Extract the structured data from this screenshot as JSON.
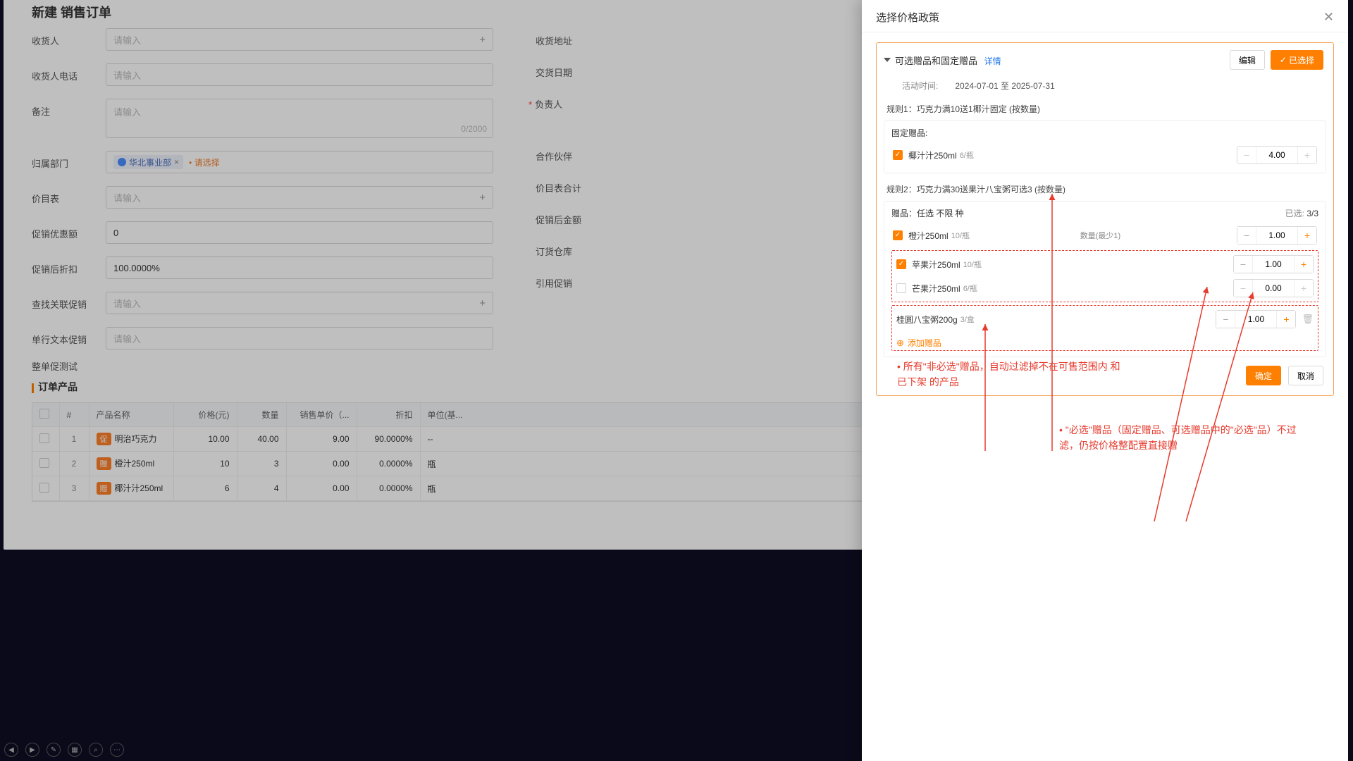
{
  "page": {
    "title": "新建 销售订单",
    "fields": {
      "consignee": {
        "label": "收货人",
        "ph": "请输入"
      },
      "addr": {
        "label": "收货地址"
      },
      "phone": {
        "label": "收货人电话",
        "ph": "请输入"
      },
      "deliverDate": {
        "label": "交货日期"
      },
      "remark": {
        "label": "备注",
        "ph": "请输入",
        "counter": "0/2000"
      },
      "owner": {
        "label": "负责人"
      },
      "dept": {
        "label": "归属部门",
        "tag": "华北事业部",
        "hint": "请选择"
      },
      "partner": {
        "label": "合作伙伴"
      },
      "priceList": {
        "label": "价目表",
        "ph": "请输入"
      },
      "priceListSum": {
        "label": "价目表合计"
      },
      "promoDiscount": {
        "label": "促销优惠额",
        "value": "0"
      },
      "afterPromo": {
        "label": "促销后金额"
      },
      "afterPromoRate": {
        "label": "促销后折扣",
        "value": "100.0000%"
      },
      "warehouse": {
        "label": "订货仓库"
      },
      "relPromo": {
        "label": "查找关联促销",
        "ph": "请输入"
      },
      "refPromo": {
        "label": "引用促销"
      },
      "lineTextPromo": {
        "label": "单行文本促销",
        "ph": "请输入"
      }
    },
    "sectionPromoTest": "整单促测试",
    "productsTab": "订单产品",
    "table": {
      "cols": {
        "hash": "#",
        "name": "产品名称",
        "price": "价格(元)",
        "qty": "数量",
        "sale": "销售单价（...",
        "disc": "折扣",
        "unit": "单位(基..."
      },
      "rows": [
        {
          "name": "明治巧克力",
          "badge": "促",
          "price": "10.00",
          "qty": "40.00",
          "sale": "9.00",
          "disc": "90.0000%",
          "unit": "--"
        },
        {
          "name": "橙汁250ml",
          "badge": "赠",
          "price": "10",
          "qty": "3",
          "sale": "0.00",
          "disc": "0.0000%",
          "unit": "瓶"
        },
        {
          "name": "椰汁汁250ml",
          "badge": "赠",
          "price": "6",
          "qty": "4",
          "sale": "0.00",
          "disc": "0.0000%",
          "unit": "瓶"
        }
      ]
    }
  },
  "modal": {
    "title": "选择价格政策",
    "edit": "编辑",
    "selected": "已选择",
    "policyTitle": "可选赠品和固定赠品",
    "detail": "详情",
    "timeLabel": "活动时间:",
    "timeRange": "2024-07-01 至 2025-07-31",
    "rule1": {
      "title": "规则1：巧克力满10送1椰汁固定 (按数量)",
      "fixedLabel": "固定赠品:",
      "item": {
        "name": "椰汁汁250ml",
        "spec": "6/瓶",
        "qty": "4.00"
      }
    },
    "rule2": {
      "title": "规则2：巧克力满30送果汁八宝粥可选3 (按数量)",
      "sub": "赠品：任选 不限 种",
      "selectedLabel": "已选:",
      "selectedCount": "3/3",
      "qtyHint": "数量(最少1)",
      "items": [
        {
          "name": "橙汁250ml",
          "spec": "10/瓶",
          "checked": true,
          "qty": "1.00",
          "plusOn": true
        },
        {
          "name": "苹果汁250ml",
          "spec": "10/瓶",
          "checked": true,
          "qty": "1.00",
          "plusOn": true
        },
        {
          "name": "芒果汁250ml",
          "spec": "6/瓶",
          "checked": false,
          "qty": "0.00",
          "plusOn": false
        }
      ],
      "extra": {
        "name": "桂圆八宝粥200g",
        "spec": "3/盒",
        "qty": "1.00"
      },
      "addGift": "添加赠品"
    },
    "confirm": "确定",
    "cancel": "取消"
  },
  "annot": {
    "note1": "所有\"非必选\"赠品，自动过滤掉不在可售范围内  和 已下架 的产品",
    "note2": "\"必选\"赠品（固定赠品、可选赠品中的\"必选\"品）不过滤，仍按价格整配置直接赠"
  }
}
